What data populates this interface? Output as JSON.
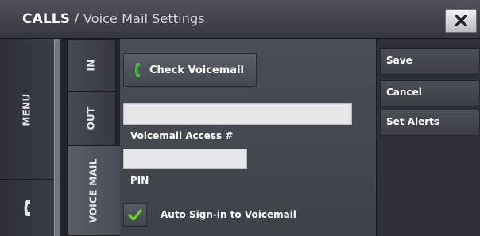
{
  "titlebar": {
    "section": "CALLS",
    "separator": " / ",
    "subtitle": "Voice Mail Settings",
    "close_icon": "close-x-icon"
  },
  "leftpanel": {
    "menu_label": "MENU",
    "phone_icon": "phone-handset-icon"
  },
  "tabs": [
    {
      "label": "IN",
      "active": false
    },
    {
      "label": "OUT",
      "active": false
    },
    {
      "label": "VOICE MAIL",
      "active": true
    }
  ],
  "content": {
    "check_voicemail": {
      "label": "Check Voicemail",
      "icon": "phone-handset-icon",
      "icon_color": "#3fbf3a"
    },
    "access_field": {
      "label": "Voicemail Access #",
      "value": ""
    },
    "pin_field": {
      "label": "PIN",
      "value": ""
    },
    "auto_signin": {
      "label": "Auto Sign-in to Voicemail",
      "checked": true,
      "check_color": "#6fd02c"
    }
  },
  "actions": [
    {
      "label": "Save"
    },
    {
      "label": "Cancel"
    },
    {
      "label": "Set Alerts"
    }
  ]
}
